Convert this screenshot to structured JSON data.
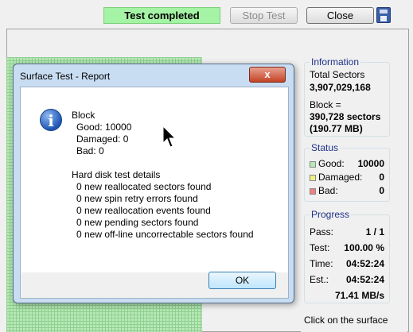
{
  "toolbar": {
    "status": "Test completed",
    "stop_label": "Stop Test",
    "close_label": "Close",
    "save_icon": "floppy-disk-icon"
  },
  "information": {
    "title": "Information",
    "total_sectors_label": "Total Sectors",
    "total_sectors_value": "3,907,029,168",
    "block_label": "Block =",
    "block_sectors": "390,728 sectors",
    "block_size": "(190.77 MB)"
  },
  "status": {
    "title": "Status",
    "good_label": "Good:",
    "good_value": "10000",
    "damaged_label": "Damaged:",
    "damaged_value": "0",
    "bad_label": "Bad:",
    "bad_value": "0",
    "colors": {
      "good": "#b8e8b8",
      "damaged": "#f0f080",
      "bad": "#f08080"
    }
  },
  "progress": {
    "title": "Progress",
    "pass_label": "Pass:",
    "pass_value": "1 / 1",
    "test_label": "Test:",
    "test_value": "100.00 %",
    "time_label": "Time:",
    "time_value": "04:52:24",
    "est_label": "Est.:",
    "est_value": "04:52:24",
    "speed": "71.41 MB/s"
  },
  "hint": "Click on the surface",
  "dialog": {
    "title": "Surface Test - Report",
    "close_glyph": "x",
    "icon": "info-icon",
    "block_heading": "Block",
    "good": "Good: 10000",
    "damaged": "Damaged: 0",
    "bad": "Bad: 0",
    "details_heading": "Hard disk test details",
    "details": [
      "0 new reallocated sectors found",
      "0 new spin retry errors found",
      "0 new reallocation events found",
      "0 new pending sectors found",
      "0 new off-line uncorrectable sectors found"
    ],
    "ok_label": "OK"
  }
}
